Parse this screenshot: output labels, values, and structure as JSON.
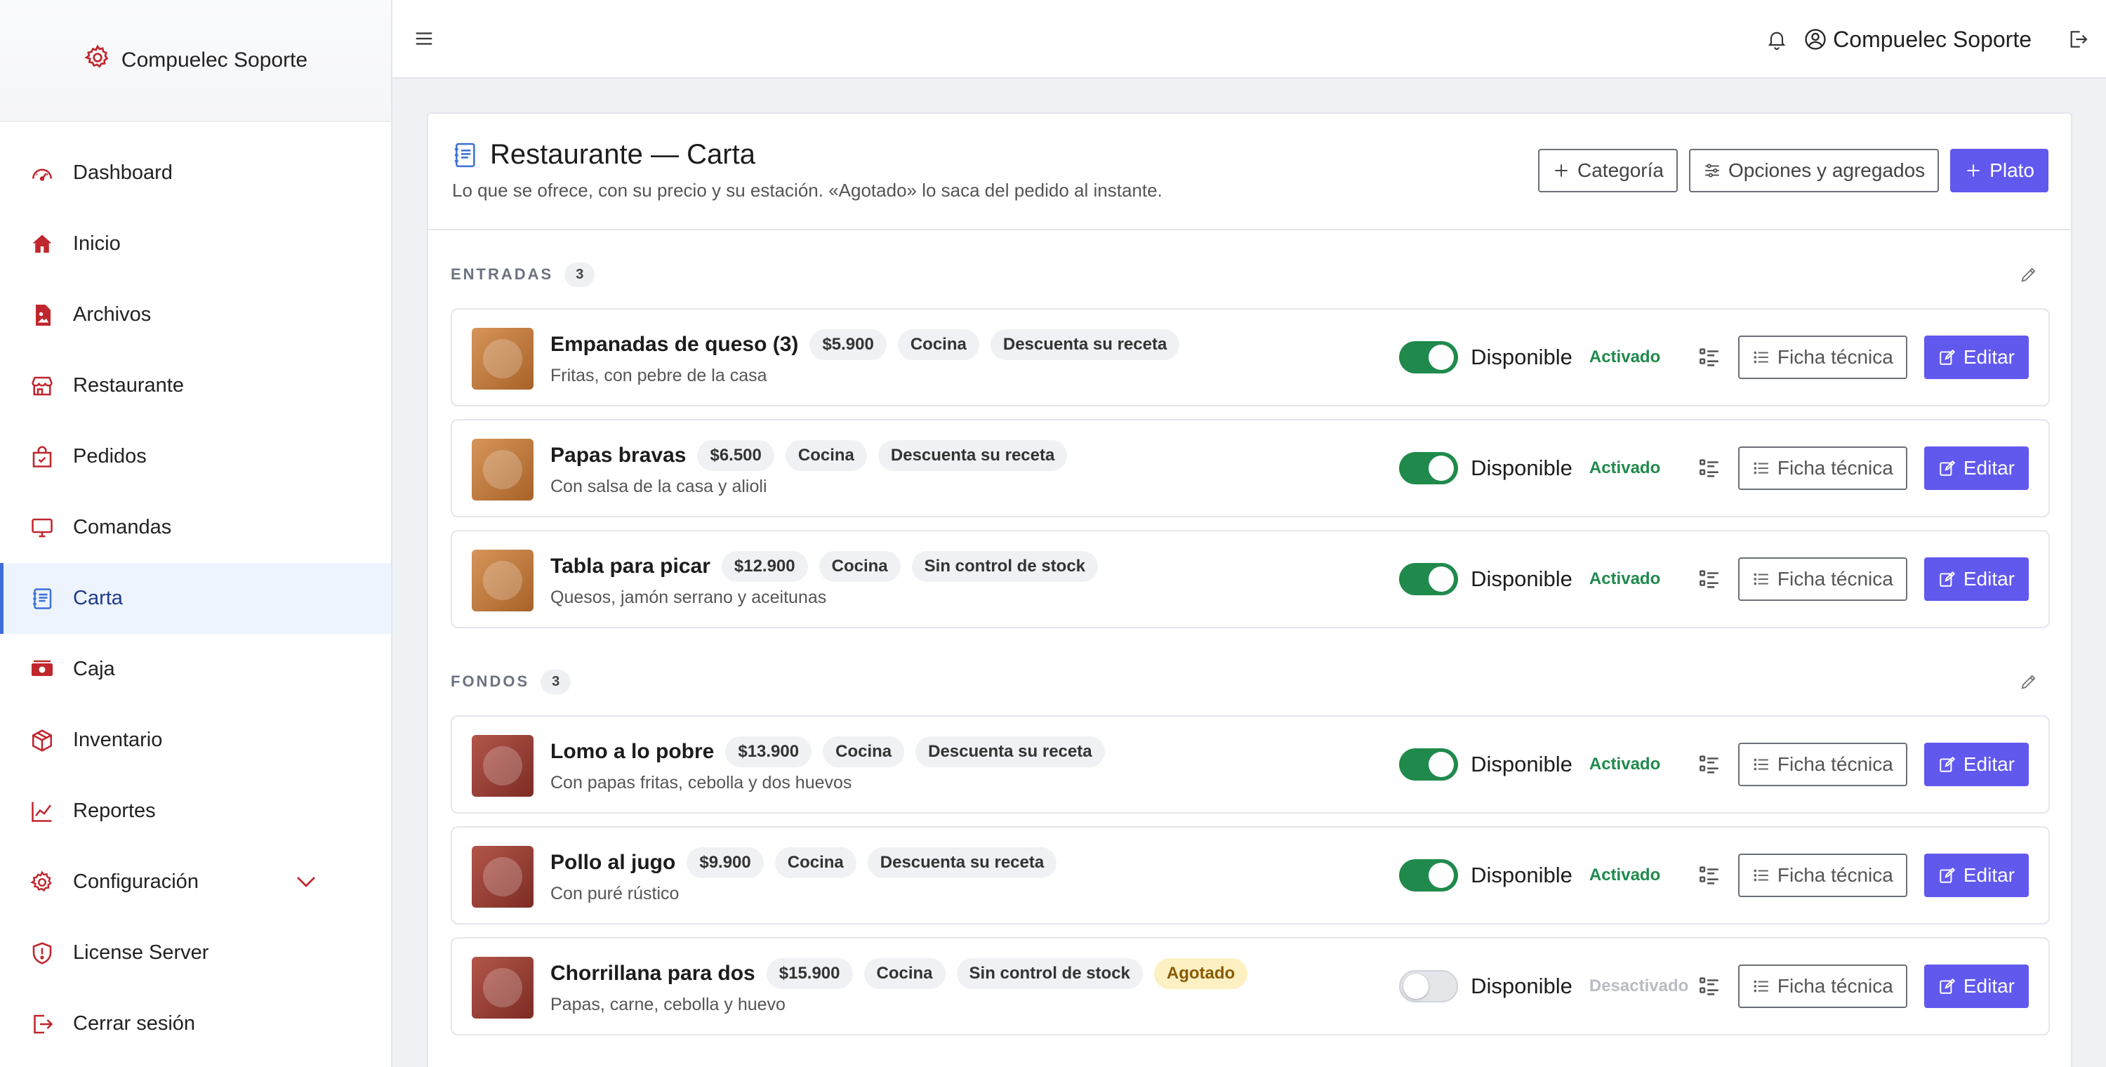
{
  "brand": {
    "name": "Compuelec Soporte"
  },
  "sidebar": {
    "items": [
      {
        "label": "Dashboard",
        "icon": "gauge-icon"
      },
      {
        "label": "Inicio",
        "icon": "house-icon"
      },
      {
        "label": "Archivos",
        "icon": "image-file-icon"
      },
      {
        "label": "Restaurante",
        "icon": "shop-icon"
      },
      {
        "label": "Pedidos",
        "icon": "bag-check-icon"
      },
      {
        "label": "Comandas",
        "icon": "monitor-icon"
      },
      {
        "label": "Carta",
        "icon": "journal-icon",
        "active": true
      },
      {
        "label": "Caja",
        "icon": "cash-icon"
      },
      {
        "label": "Inventario",
        "icon": "box-icon"
      },
      {
        "label": "Reportes",
        "icon": "graph-icon"
      },
      {
        "label": "Configuración",
        "icon": "gear-icon",
        "expandable": true
      },
      {
        "label": "License Server",
        "icon": "shield-icon"
      },
      {
        "label": "Cerrar sesión",
        "icon": "logout-icon"
      }
    ]
  },
  "topbar": {
    "user_name": "Compuelec Soporte"
  },
  "page": {
    "title": "Restaurante — Carta",
    "subtitle": "Lo que se ofrece, con su precio y su estación. «Agotado» lo saca del pedido al instante.",
    "actions": {
      "category": "Categoría",
      "options": "Opciones y agregados",
      "dish": "Plato"
    }
  },
  "labels": {
    "available": "Disponible",
    "enabled": "Activado",
    "disabled": "Desactivado",
    "tech_sheet": "Ficha técnica",
    "edit": "Editar"
  },
  "sections": [
    {
      "title": "ENTRADAS",
      "count": "3",
      "dishes": [
        {
          "name": "Empanadas de queso (3)",
          "price": "$5.900",
          "station": "Cocina",
          "stock": "Descuenta su receta",
          "description": "Fritas, con pebre de la casa",
          "available": true,
          "status": "Activado"
        },
        {
          "name": "Papas bravas",
          "price": "$6.500",
          "station": "Cocina",
          "stock": "Descuenta su receta",
          "description": "Con salsa de la casa y alioli",
          "available": true,
          "status": "Activado"
        },
        {
          "name": "Tabla para picar",
          "price": "$12.900",
          "station": "Cocina",
          "stock": "Sin control de stock",
          "description": "Quesos, jamón serrano y aceitunas",
          "available": true,
          "status": "Activado"
        }
      ]
    },
    {
      "title": "FONDOS",
      "count": "3",
      "dishes": [
        {
          "name": "Lomo a lo pobre",
          "price": "$13.900",
          "station": "Cocina",
          "stock": "Descuenta su receta",
          "description": "Con papas fritas, cebolla y dos huevos",
          "available": true,
          "status": "Activado"
        },
        {
          "name": "Pollo al jugo",
          "price": "$9.900",
          "station": "Cocina",
          "stock": "Descuenta su receta",
          "description": "Con puré rústico",
          "available": true,
          "status": "Activado"
        },
        {
          "name": "Chorrillana para dos",
          "price": "$15.900",
          "station": "Cocina",
          "stock": "Sin control de stock",
          "badge": "Agotado",
          "description": "Papas, carne, cebolla y huevo",
          "available": false,
          "status": "Desactivado"
        }
      ]
    }
  ],
  "colors": {
    "primary": "#6158ee",
    "success": "#1f8a4c",
    "danger": "#c0262d",
    "active_nav": "#eef4fd"
  }
}
